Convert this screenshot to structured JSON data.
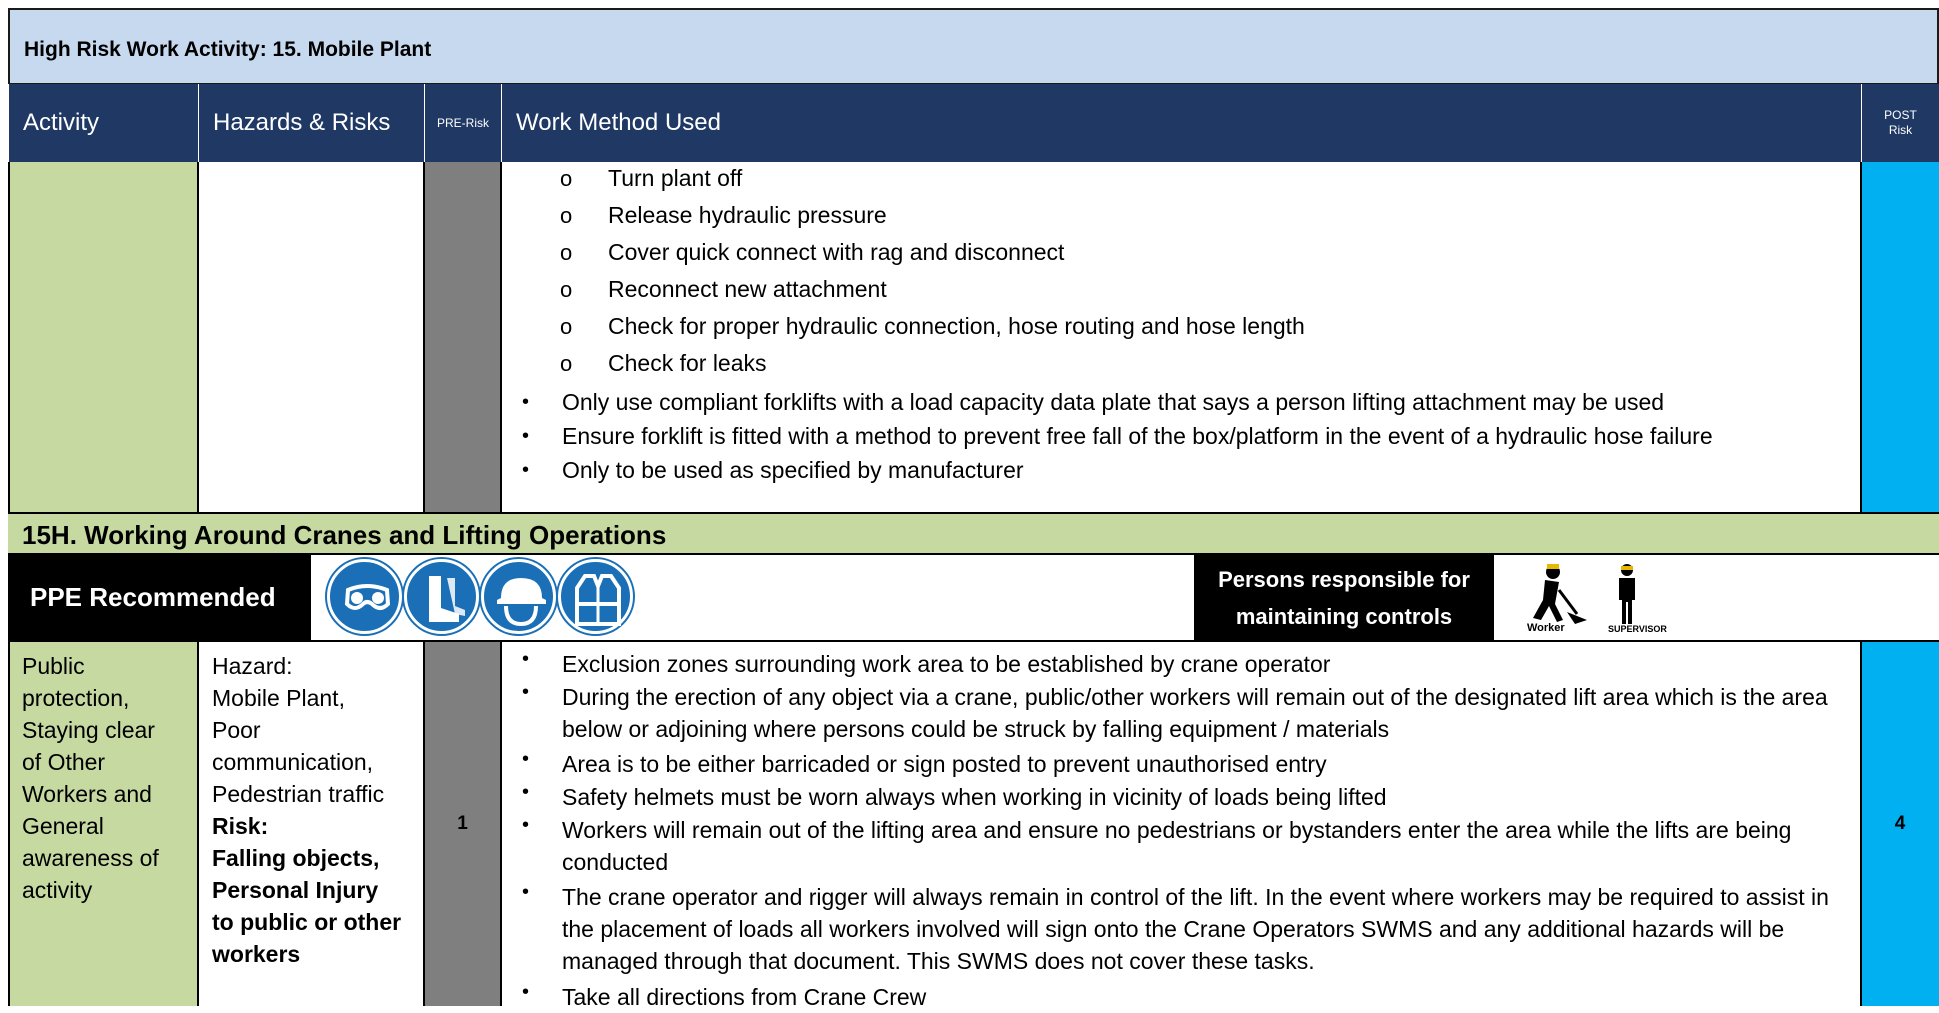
{
  "activity_title": "High Risk Work Activity: 15. Mobile Plant",
  "columns": {
    "activity": "Activity",
    "hazards": "Hazards & Risks",
    "pre_risk": "PRE-Risk",
    "method": "Work Method Used",
    "post_risk_line1": "POST",
    "post_risk_line2": "Risk"
  },
  "top_sub_items": [
    "Turn plant off",
    "Release hydraulic pressure",
    "Cover quick connect with rag and disconnect",
    "Reconnect new attachment",
    "Check for proper hydraulic connection, hose routing and hose length",
    "Check for leaks"
  ],
  "sub_marker": "o",
  "bullet_marker": "•",
  "top_bullets": [
    "Only use compliant forklifts with a load capacity data plate that says a person lifting attachment may be used",
    "Ensure forklift is fitted with a method to prevent free fall of the box/platform in the event of a hydraulic hose failure",
    "Only to be used as specified by manufacturer"
  ],
  "section_title": "15H. Working Around Cranes and Lifting Operations",
  "ppe": {
    "label": "PPE Recommended",
    "icons": [
      "eye-protection-icon",
      "safety-boots-icon",
      "hard-hat-icon",
      "hi-vis-vest-icon"
    ],
    "color": "#1a6fb6"
  },
  "persons": {
    "line1": "Persons responsible for",
    "line2": "maintaining controls",
    "worker_label": "Worker",
    "supervisor_label": "SUPERVISOR"
  },
  "row": {
    "activity_lines": [
      "Public",
      "protection,",
      "Staying clear",
      "of Other",
      "Workers and",
      "General",
      "awareness of",
      "activity"
    ],
    "hazard_lines": [
      "Hazard:",
      "Mobile Plant,",
      "Poor",
      "communication,",
      "Pedestrian traffic"
    ],
    "risk_lines": [
      "Risk:",
      "Falling objects,",
      "Personal Injury",
      "to public or other",
      "workers"
    ],
    "pre_risk": "1",
    "post_risk": "4",
    "bullets": [
      "Exclusion zones surrounding work area to be established by crane operator",
      "During the erection of any object via a crane, public/other workers will remain out of the designated lift area which is the area below or adjoining where persons could be struck by falling equipment / materials",
      "Area is to be either barricaded or sign posted to prevent unauthorised entry",
      "Safety helmets must be worn always when working in vicinity of loads being lifted",
      "Workers will remain out of the lifting area and ensure no pedestrians or bystanders enter the area while the lifts are being conducted",
      "The crane operator and rigger will always remain in control of the lift. In the event where workers may be required to assist in the placement of loads all workers involved will sign onto the Crane Operators SWMS and any additional hazards will be managed through that document. This SWMS does not cover these tasks.",
      "Take all directions from Crane Crew"
    ]
  },
  "colors": {
    "header_blue": "#1f3864",
    "title_bg": "#c7d9ef",
    "activity_green": "#c6d9a1",
    "pre_risk_grey": "#7f7f7f",
    "post_risk_blue": "#00b0f0"
  }
}
